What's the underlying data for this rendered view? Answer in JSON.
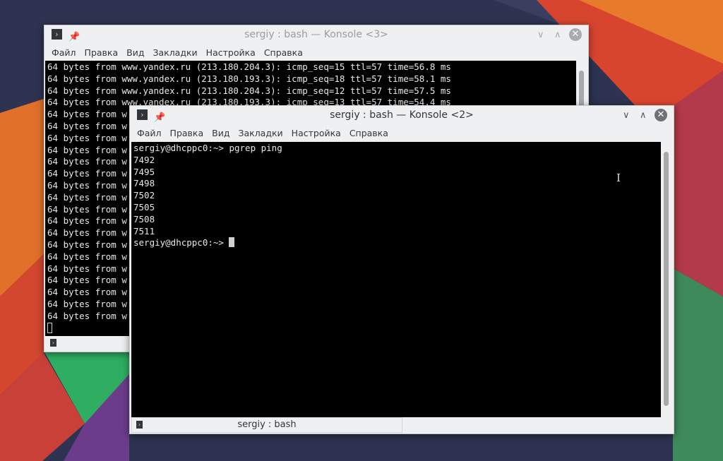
{
  "back_window": {
    "title": "sergiy : bash — Konsole <3>",
    "menu": [
      "Файл",
      "Правка",
      "Вид",
      "Закладки",
      "Настройка",
      "Справка"
    ],
    "lines": [
      "64 bytes from www.yandex.ru (213.180.204.3): icmp_seq=15 ttl=57 time=56.8 ms",
      "64 bytes from www.yandex.ru (213.180.193.3): icmp_seq=18 ttl=57 time=58.1 ms",
      "64 bytes from www.yandex.ru (213.180.204.3): icmp_seq=12 ttl=57 time=57.5 ms",
      "64 bytes from www.yandex.ru (213.180.193.3): icmp_seq=13 ttl=57 time=54.4 ms",
      "64 bytes from w",
      "64 bytes from w",
      "64 bytes from w",
      "64 bytes from w",
      "64 bytes from w",
      "64 bytes from w",
      "64 bytes from w",
      "64 bytes from w",
      "64 bytes from w",
      "64 bytes from w",
      "64 bytes from w",
      "64 bytes from w",
      "64 bytes from w",
      "64 bytes from w",
      "64 bytes from w",
      "64 bytes from w",
      "64 bytes from w",
      "64 bytes from w"
    ]
  },
  "front_window": {
    "title": "sergiy : bash — Konsole <2>",
    "menu": [
      "Файл",
      "Правка",
      "Вид",
      "Закладки",
      "Настройка",
      "Справка"
    ],
    "lines": [
      "sergiy@dhcppc0:~> pgrep ping",
      "7492",
      "7495",
      "7498",
      "7502",
      "7505",
      "7508",
      "7511"
    ],
    "prompt": "sergiy@dhcppc0:~> ",
    "tab_label": "sergiy : bash"
  }
}
